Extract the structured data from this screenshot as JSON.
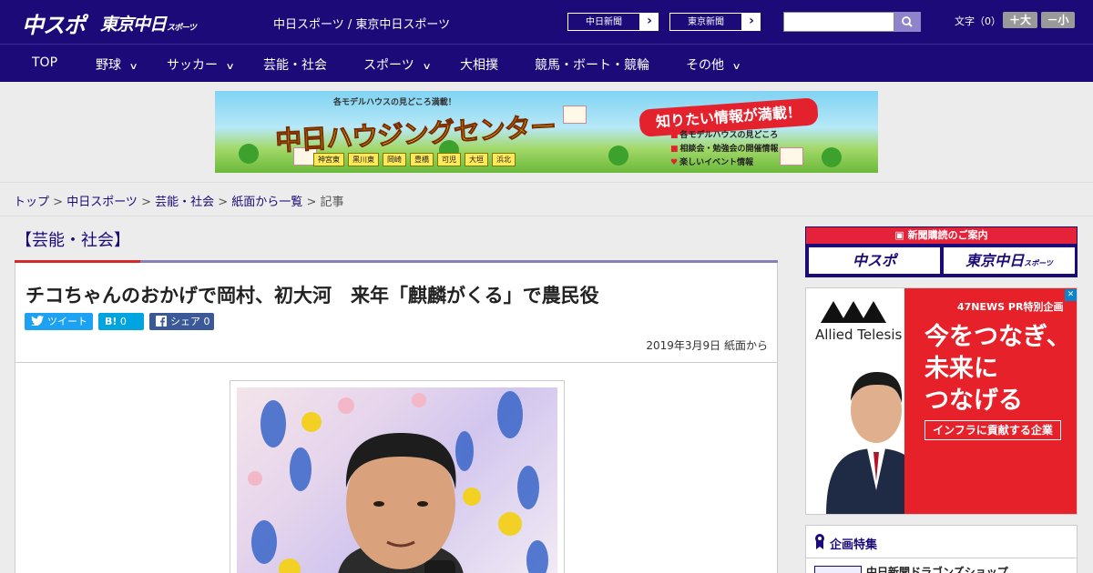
{
  "header": {
    "logo_chuspo": "中スポ",
    "logo_tokyo": "東京中日",
    "logo_tokyo_small": "スポーツ",
    "site_names": "中日スポーツ / 東京中日スポーツ",
    "link_chunichi": "中日新聞",
    "link_tokyo": "東京新聞",
    "search_placeholder": "",
    "font_label": "文字（0）",
    "font_larger": "＋大",
    "font_smaller": "－小"
  },
  "nav": {
    "items": [
      "TOP",
      "野球",
      "サッカー",
      "芸能・社会",
      "スポーツ",
      "大相撲",
      "競馬・ボート・競輪",
      "その他"
    ]
  },
  "banner": {
    "sub": "各モデルハウスの見どころ満載！",
    "main": "中日ハウジングセンター",
    "badge": "知りたい情報が満載！",
    "bullets": [
      "各モデルハウスの見どころ",
      "相談会・勉強会の開催情報",
      "楽しいイベント情報"
    ],
    "places": [
      "神宮東",
      "黒川東",
      "岡崎",
      "豊橋",
      "可児",
      "大垣",
      "浜北"
    ]
  },
  "breadcrumb": {
    "items": [
      "トップ",
      "中日スポーツ",
      "芸能・社会",
      "紙面から一覧"
    ],
    "current": "記事",
    "sep": " > "
  },
  "article": {
    "category": "【芸能・社会】",
    "headline": "チコちゃんのおかげで岡村、初大河　来年「麒麟がくる」で農民役",
    "tweet_label": "ツイート",
    "hatena_label": "B!",
    "hatena_count": "0",
    "share_label": "シェア",
    "share_count": "0",
    "date": "2019年3月9日 紙面から"
  },
  "sidebar": {
    "subscribe_head": "新聞購読のご案内",
    "subscribe_chuspo": "中スポ",
    "subscribe_tokyo": "東京中日",
    "subscribe_tokyo_small": "スポーツ",
    "ad_tag": "47NEWS PR特別企画",
    "ad_copy": [
      "今をつなぎ、",
      "未来に",
      "つなげる"
    ],
    "ad_button": "インフラに貢献する企業",
    "ad_logo": "Allied Telesis",
    "feature_title": "企画特集",
    "feature_item": "中日新聞ドラゴンズショップ"
  },
  "colors": {
    "brand": "#1c0a78",
    "accent_red": "#e4233a",
    "twitter": "#1da1f2",
    "hatena": "#00a4de",
    "facebook": "#3b5998"
  }
}
